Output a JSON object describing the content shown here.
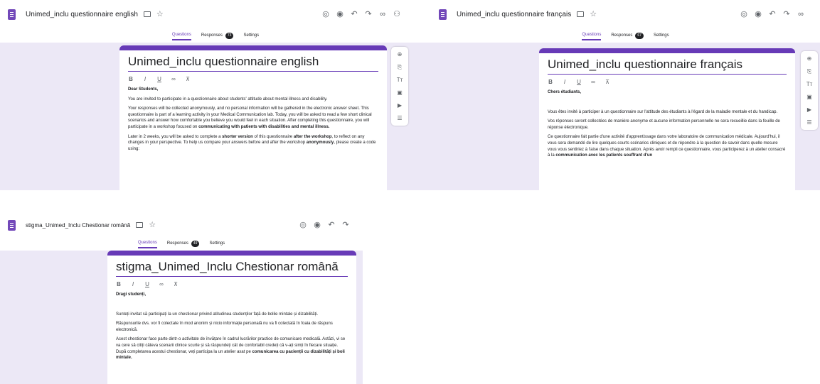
{
  "accent_color": "#673ab7",
  "background_color": "#ece8f6",
  "icons": {
    "app": "google-forms-icon",
    "folder": "folder-icon",
    "star": "star-icon",
    "toolbar": [
      "palette-icon",
      "preview-eye-icon",
      "undo-icon",
      "redo-icon",
      "link-icon",
      "add-collaborator-icon"
    ],
    "sidebar": [
      "add-question-icon",
      "import-questions-icon",
      "add-title-icon",
      "add-image-icon",
      "add-video-icon",
      "add-section-icon"
    ],
    "format": [
      "bold-icon",
      "italic-icon",
      "underline-icon",
      "link-icon",
      "clear-format-icon"
    ]
  },
  "english": {
    "doc_title": "Unimed_inclu questionnaire english",
    "tabs": {
      "questions": "Questions",
      "responses": "Responses",
      "responses_count": "73",
      "settings": "Settings"
    },
    "form_title": "Unimed_inclu questionnaire english",
    "greeting": "Dear Students,",
    "p1": "You are invited to participate in a questionnaire about students' attitude about mental illness and disability.",
    "p2a": "Your responses will be collected anonymously, and no personal information will be gathered in the electronic answer sheet. This questionnaire is part of a learning activity in your Medical Communication lab. Today, you will be asked to read a few short clinical scenarios and answer how comfortable you believe you would feel in each situation. After completing this questionnaire, you will participate in a workshop focused on",
    "p2b": "communicating with patients with disabilities and mental illness",
    "p2c": ".",
    "p3a": "Later in 2 weeks, you will be asked to complete a",
    "p3b": "shorter version",
    "p3c": "of this questionnaire",
    "p3d": "after the workshop",
    "p3e": ", to reflect on any changes in your perspective. To help us compare your answers before and after the workshop",
    "p3f": "anonymously",
    "p3g": ", please create a code using:"
  },
  "french": {
    "doc_title": "Unimed_inclu questionnaire français",
    "tabs": {
      "questions": "Questions",
      "responses": "Responses",
      "responses_count": "67",
      "settings": "Settings"
    },
    "form_title": "Unimed_inclu questionnaire français",
    "greeting": "Chers étudiants,",
    "p1": "Vous êtes invité à participer à un questionnaire sur l'attitude des étudiants à l'égard de la maladie mentale et du handicap.",
    "p2": "Vos réponses seront collectées de manière anonyme et aucune information personnelle ne sera recueillie dans la feuille de réponse électronique.",
    "p3a": "Ce questionnaire fait partie d'une activité d'apprentissage dans votre laboratoire de communication médicale. Aujourd'hui, il vous sera demandé de lire quelques courts scénarios cliniques et de répondre à la question de savoir dans quelle mesure vous vous sentiriez à l'aise dans chaque situation. Après avoir rempli ce questionnaire, vous participerez à un atelier consacré à la",
    "p3b": "communication avec les patients souffrant d'un"
  },
  "romanian": {
    "doc_title": "stigma_Unimed_Inclu Chestionar română",
    "tabs": {
      "questions": "Questions",
      "responses": "Responses",
      "responses_count": "49",
      "settings": "Settings"
    },
    "form_title": "stigma_Unimed_Inclu Chestionar română",
    "greeting": "Dragi studenți,",
    "p1": "Sunteți invitat să participați la un chestionar privind atitudinea studenților față de bolile mintale și dizabilități.",
    "p2": "Răspunsurile dvs. vor fi colectate în mod anonim și nicio informație personală nu va fi colectată în foaia de răspuns electronică.",
    "p3a": "Acest chestionar face parte dintr-o activitate de învățare în cadrul lucrărilor practice de comunicare medicală. Astăzi, vi se va cere să citiți câteva scenarii clinice scurte și să răspundeți cât de confortabil credeți că v-ați simți în fiecare situație. După completarea acestui chestionar, veți participa la un atelier axat pe",
    "p3b": "comunicarea cu pacienții cu dizabilități și boli mintale",
    "p3c": "."
  }
}
